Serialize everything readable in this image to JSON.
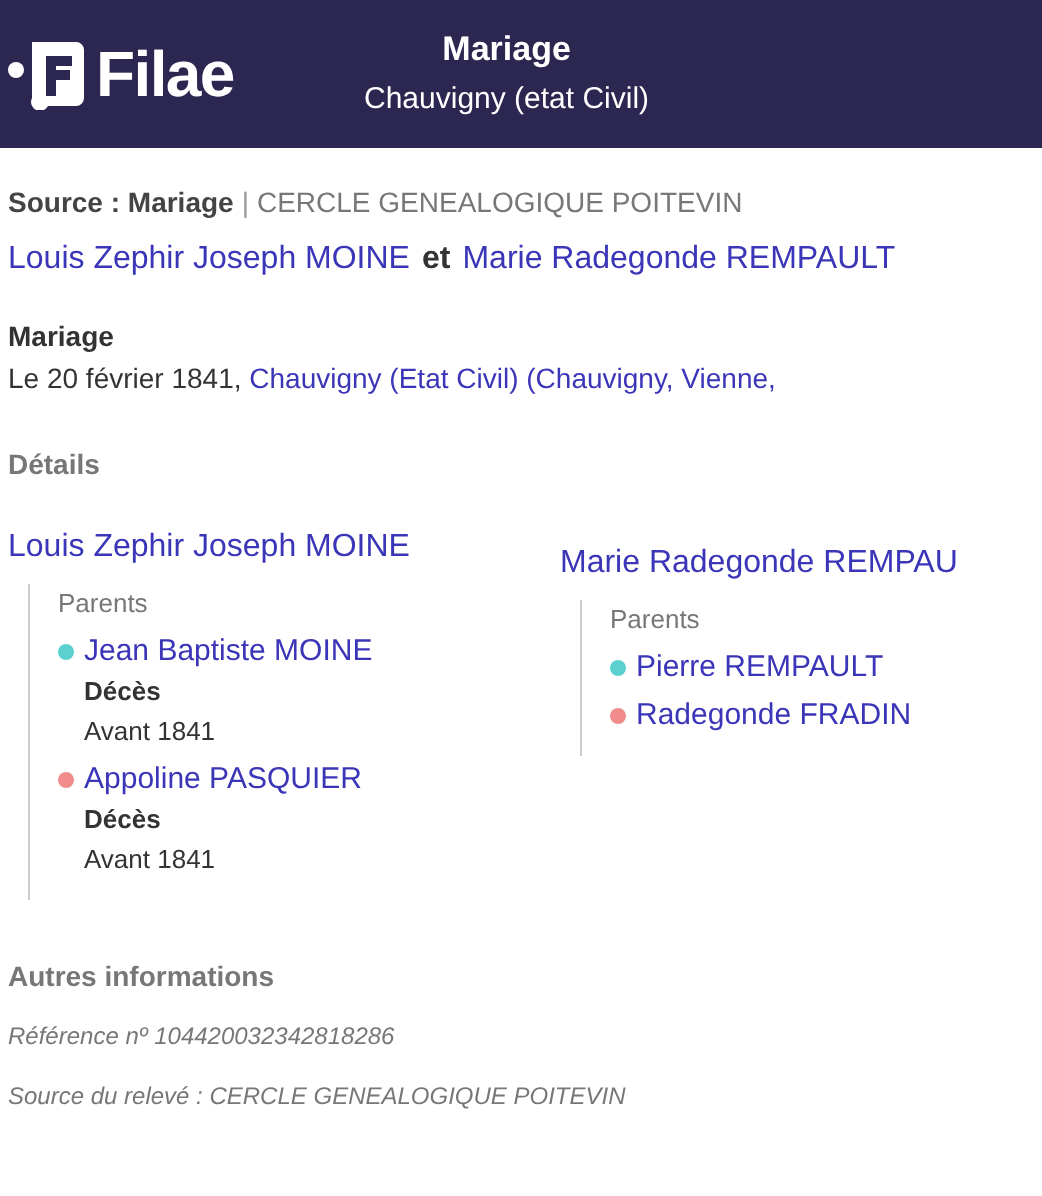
{
  "header": {
    "logo": "Filae",
    "title": "Mariage",
    "subtitle": "Chauvigny (etat Civil)"
  },
  "source": {
    "label": "Source : Mariage",
    "separator": "|",
    "value": "CERCLE GENEALOGIQUE POITEVIN"
  },
  "couple": {
    "spouses": [
      "Louis Zephir Joseph MOINE",
      "Marie Radegonde REMPAULT"
    ],
    "conjunction": "et"
  },
  "event": {
    "title": "Mariage",
    "date_text": "Le 20 février 1841,",
    "place_link": "Chauvigny (Etat Civil) (Chauvigny, Vienne,"
  },
  "details": {
    "heading": "Détails",
    "persons": [
      {
        "name": "Louis Zephir Joseph MOINE",
        "parents_label": "Parents",
        "parents": [
          {
            "name": "Jean Baptiste MOINE",
            "color": "#5ccfcf",
            "event": {
              "label": "Décès",
              "value": "Avant 1841"
            }
          },
          {
            "name": "Appoline PASQUIER",
            "color": "#f08c8c",
            "event": {
              "label": "Décès",
              "value": "Avant 1841"
            }
          }
        ]
      },
      {
        "name": "Marie Radegonde REMPAU",
        "parents_label": "Parents",
        "parents": [
          {
            "name": "Pierre REMPAULT",
            "color": "#5ccfcf"
          },
          {
            "name": "Radegonde FRADIN",
            "color": "#f08c8c"
          }
        ]
      }
    ]
  },
  "other": {
    "heading": "Autres informations",
    "lines": [
      "Référence nº 104420032342818286",
      "Source du relevé : CERCLE GENEALOGIQUE POITEVIN"
    ]
  }
}
